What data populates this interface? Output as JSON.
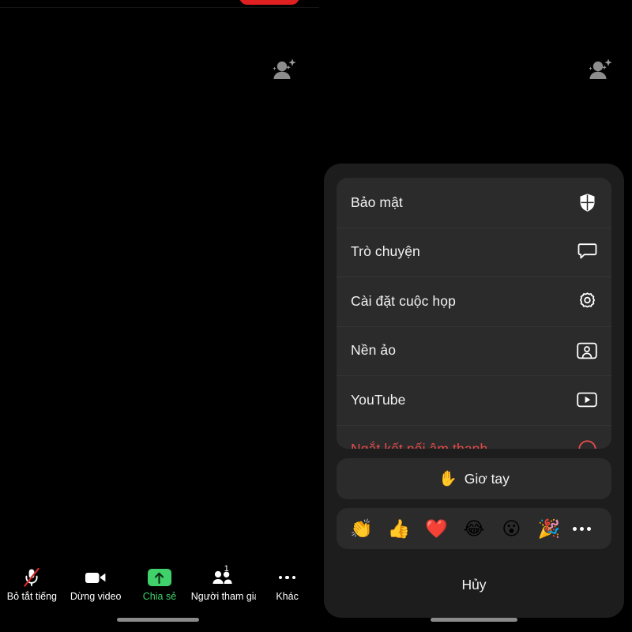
{
  "stage": {
    "avatars": [
      {
        "icon": "person-sparkle-icon"
      },
      {
        "icon": "person-sparkle-icon"
      }
    ],
    "notification_pill": {
      "color": "#e02020"
    }
  },
  "toolbar": {
    "items": [
      {
        "id": "mute",
        "label": "Bỏ tắt tiếng",
        "icon": "microphone-muted-icon",
        "accent": false
      },
      {
        "id": "video",
        "label": "Dừng video",
        "icon": "video-camera-icon",
        "accent": false
      },
      {
        "id": "share",
        "label": "Chia sẻ",
        "icon": "share-arrow-up-icon",
        "accent": true
      },
      {
        "id": "participants",
        "label": "Người tham gia",
        "icon": "participants-icon",
        "accent": false,
        "badge": "1"
      },
      {
        "id": "more",
        "label": "Khác",
        "icon": "more-dots-icon",
        "accent": false
      }
    ],
    "accent_color": "#41d16a"
  },
  "sheet": {
    "menu": [
      {
        "label": "Bảo mật",
        "icon": "shield-icon",
        "danger": false
      },
      {
        "label": "Trò chuyện",
        "icon": "chat-bubble-icon",
        "danger": false
      },
      {
        "label": "Cài đặt cuộc họp",
        "icon": "gear-icon",
        "danger": false
      },
      {
        "label": "Nền ảo",
        "icon": "virtual-background-icon",
        "danger": false
      },
      {
        "label": "YouTube",
        "icon": "youtube-play-icon",
        "danger": false
      },
      {
        "label": "Ngắt kết nối âm thanh",
        "icon": "disconnect-audio-icon",
        "danger": true
      }
    ],
    "raise_hand": {
      "emoji": "✋",
      "label": "Giơ tay"
    },
    "reactions": [
      {
        "emoji": "👏",
        "name": "clap-reaction"
      },
      {
        "emoji": "👍",
        "name": "thumbs-up-reaction"
      },
      {
        "emoji": "❤️",
        "name": "heart-reaction"
      },
      {
        "emoji": "😂",
        "name": "joy-reaction"
      },
      {
        "emoji": "😮",
        "name": "open-mouth-reaction"
      },
      {
        "emoji": "🎉",
        "name": "party-popper-reaction"
      }
    ],
    "more_reactions_label": "•••",
    "cancel_label": "Hủy",
    "danger_color": "#e54b4b"
  }
}
